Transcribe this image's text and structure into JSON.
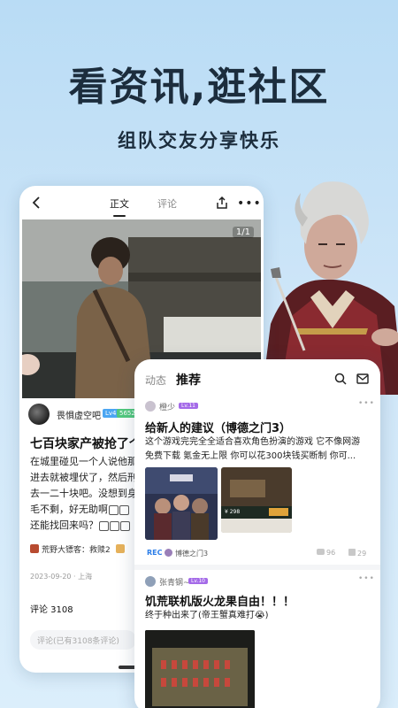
{
  "headline": "看资讯,逛社区",
  "subline": "组队交友分享快乐",
  "article_screen": {
    "tab_main": "正文",
    "tab_comment": "评论",
    "photo_counter": "1/1",
    "author_name": "畏惧虚空吧",
    "author_level": "Lv4",
    "author_badge": "5652",
    "title": "七百块家产被抢了个精",
    "body_lines": [
      "在城里碰见一个人说他那",
      "进去就被埋伏了，然后刑",
      "去一二十块吧。没想到身",
      "毛不剩，好无助啊",
      "还能找回来吗？"
    ],
    "tag_game": "荒野大镖客：救赎2",
    "date_location": "2023-09-20 · 上海",
    "comment_count": "评论 3108",
    "comment_placeholder": "评论(已有3108条评论)"
  },
  "feed_screen": {
    "tab_feed": "动态",
    "tab_recommend": "推荐",
    "posts": [
      {
        "user": "橙少",
        "level": "Lv.11",
        "title": "给新人的建议（博德之门3）",
        "text_lines": [
          "这个游戏完完全全适合喜欢角色扮演的游戏 它不像网游",
          "免费下载 氪金无上限 你可以花300块钱买断制 你可..."
        ],
        "price": "¥ 298",
        "rec": "REC",
        "game": "博德之门3",
        "comments": "96",
        "likes": "29"
      },
      {
        "user": "张青钢~",
        "level": "Lv.10",
        "title": "饥荒联机版火龙果自由！！！",
        "text_lines": [
          "终于种出来了(帝王蟹真难打😭)"
        ]
      }
    ]
  },
  "colors": {
    "background": "#c4e1f7",
    "accent_blue": "#2b7de8",
    "level_purple": "#a46ae8"
  }
}
